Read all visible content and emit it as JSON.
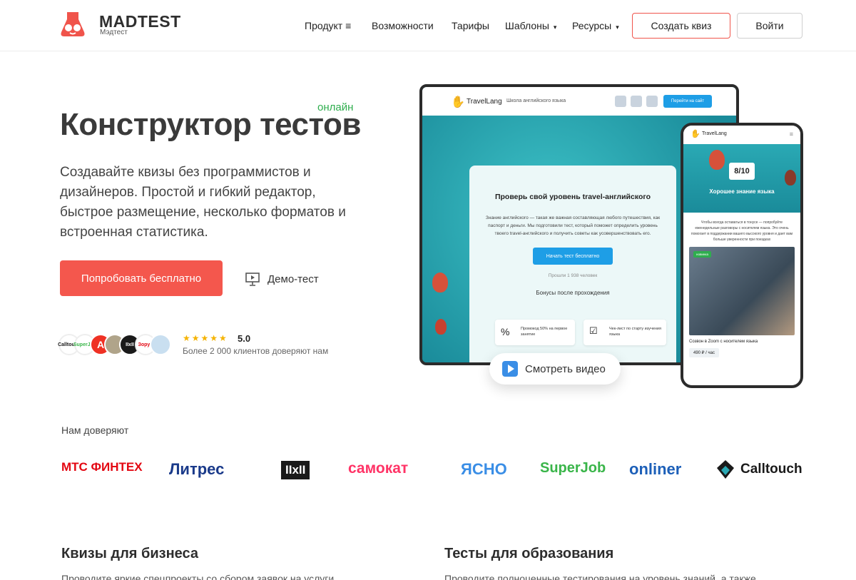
{
  "header": {
    "logo_title": "MADTEST",
    "logo_sub": "Мэдтест",
    "nav": [
      {
        "label": "Продукт",
        "suffix": "≡"
      },
      {
        "label": "Возможности",
        "suffix": ""
      },
      {
        "label": "Тарифы",
        "suffix": ""
      },
      {
        "label": "Шаблоны",
        "suffix": "▾"
      },
      {
        "label": "Ресурсы",
        "suffix": "▾"
      }
    ],
    "create_quiz": "Создать квиз",
    "login": "Войти"
  },
  "hero": {
    "badge": "онлайн",
    "title": "Конструктор тестов",
    "subtitle": "Создавайте квизы без программистов и дизайнеров. Простой и гибкий редактор, быстрое размещение, несколько форматов и встроенная статистика.",
    "cta": "Попробовать бесплатно",
    "demo": "Демо-тест",
    "rating": "5.0",
    "stars": "★★★★★",
    "trust_line": "Более 2 000 клиентов доверяют нам"
  },
  "avatars": [
    {
      "text": "Calltouch",
      "color": "#ffffff"
    },
    {
      "text": "SuperJob",
      "color": "#ffffff"
    },
    {
      "text": "А",
      "color": "#ef3124"
    },
    {
      "text": "",
      "color": "#b0a48a"
    },
    {
      "text": "IIxII",
      "color": "#1a1a1a"
    },
    {
      "text": "Зорун",
      "color": "#ffffff"
    },
    {
      "text": "",
      "color": "#c9dff0"
    }
  ],
  "mockup": {
    "brand": "TravelLang",
    "school": "Школа английского языка",
    "goto_site": "Перейти на сайт",
    "quiz_title": "Проверь свой уровень travel-английского",
    "quiz_text": "Знание английского — такая же важная составляющая любого путешествия, как паспорт и деньги. Мы подготовили тест, который поможет определить уровень твоего travel-английского и получить советы как усовершенствовать его.",
    "start_btn": "Начать тест бесплатно",
    "passed": "Прошли 1 938 человек",
    "bonus_title": "Бонусы после прохождения",
    "bonus1": "Промокод 50% на первое занятие",
    "bonus2": "Чек-лист по старту изучения языка",
    "phone_score": "8/10",
    "phone_result": "Хорошее знание языка",
    "phone_text": "Чтобы всегда оставаться в тонусе — попробуйте еженедельные разговоры с носителем языка. Это очень помогает в поддержании вашего высокого уровня и дает вам больше уверенности при поездках",
    "phone_tag": "новинка",
    "phone_course": "Созвон в Zoom с носителем языка",
    "phone_price": "490 ₽ / час",
    "watch_video": "Смотреть видео"
  },
  "trusted": {
    "title": "Нам доверяют",
    "brands": [
      {
        "name": "МТС ФИНТЕХ",
        "color": "#e30611"
      },
      {
        "name": "Литрес",
        "color": "#1a3a8a"
      },
      {
        "name": "IIxII",
        "color": "#1a1a1a"
      },
      {
        "name": "самокат",
        "color": "#ff3366"
      },
      {
        "name": "ЯСНО",
        "color": "#3a8ee6"
      },
      {
        "name": "SuperJob",
        "color": "#3ab54a"
      },
      {
        "name": "onliner",
        "color": "#1c5fb8"
      },
      {
        "name": "Calltouch",
        "color": "#1a1a1a"
      }
    ]
  },
  "sections": [
    {
      "title": "Квизы для бизнеса",
      "text": "Проводите яркие спецпроекты со сбором заявок на услуги"
    },
    {
      "title": "Тесты для образования",
      "text": "Проводите полноценные тестирования на уровень знаний, а также"
    }
  ],
  "colors": {
    "accent": "#f4574d",
    "green": "#2fae4e",
    "teal": "#2aa9b4"
  }
}
